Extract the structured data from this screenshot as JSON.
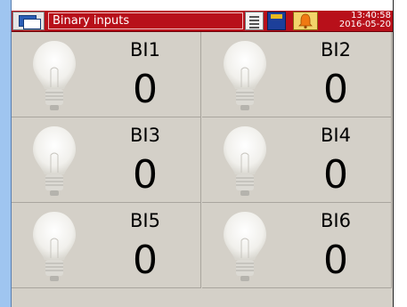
{
  "header": {
    "title": "Binary inputs",
    "time": "13:40:58",
    "date": "2016-05-20",
    "colors": {
      "bar": "#b8101a",
      "accent_text": "#ffffff"
    },
    "icons": [
      "windows-icon",
      "list-icon",
      "sd-card-icon",
      "alarm-bell-icon"
    ]
  },
  "inputs": [
    {
      "label": "BI1",
      "value": "0"
    },
    {
      "label": "BI2",
      "value": "0"
    },
    {
      "label": "BI3",
      "value": "0"
    },
    {
      "label": "BI4",
      "value": "0"
    },
    {
      "label": "BI5",
      "value": "0"
    },
    {
      "label": "BI6",
      "value": "0"
    }
  ]
}
